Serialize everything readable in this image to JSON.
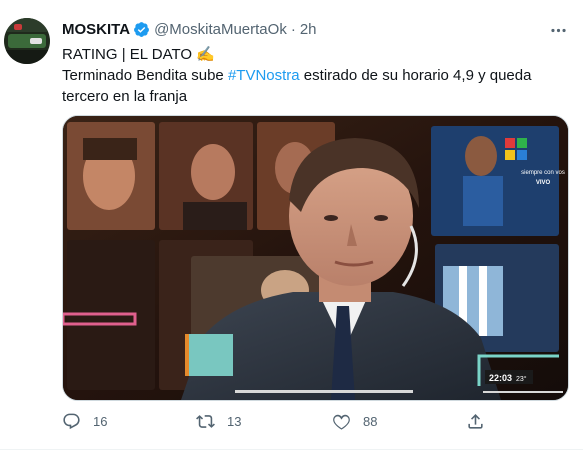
{
  "tweet": {
    "display_name": "MOSKITA",
    "handle": "@MoskitaMuertaOk",
    "separator": "·",
    "time": "2h",
    "text_line1": "RATING | EL DATO ✍️",
    "text_line2_pre": "Terminado Bendita sube ",
    "hashtag": "#TVNostra",
    "text_line2_post": " estirado de su horario 4,9 y queda",
    "text_line3": "tercero en la franja"
  },
  "media": {
    "channel_slogan_line1": "siempre con vos",
    "channel_slogan_line2": "VIVO",
    "clock": "22:03",
    "temperature": "23°"
  },
  "actions": {
    "replies": "16",
    "retweets": "13",
    "likes": "88"
  },
  "colors": {
    "accent": "#1d9bf0",
    "muted": "#536471"
  },
  "icons": [
    "verified-badge-icon",
    "more-options-icon",
    "reply-icon",
    "retweet-icon",
    "like-icon",
    "share-icon"
  ]
}
